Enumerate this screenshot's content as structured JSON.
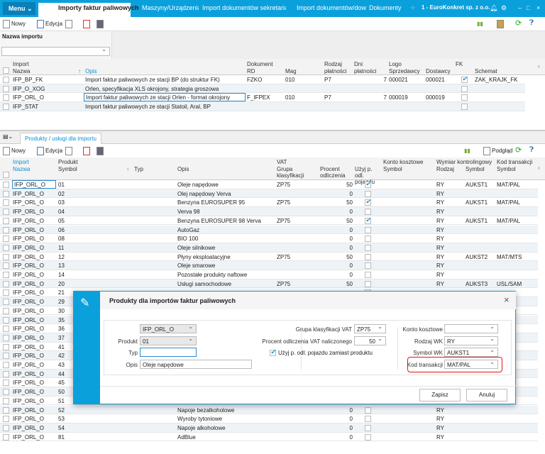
{
  "topbar": {
    "menu": "Menu",
    "tabs": [
      "Importy faktur paliwowych",
      "Maszyny/Urządzenia",
      "Import dokumentów sekretariatu",
      "Import dokumentów/dowodów",
      "Dokumenty"
    ],
    "company": "1 - EuroKonkret sp. z o.o."
  },
  "toolbar": {
    "new": "Nowy",
    "edit": "Edycja",
    "preview": "Podgląd"
  },
  "filter": {
    "label": "Nazwa importu",
    "value": ""
  },
  "top_grid": {
    "groups": {
      "import": "Import",
      "dokument": "Dokument",
      "rodzaj": "Rodzaj",
      "dni": "Dni",
      "logo": "Logo",
      "fk": "FK"
    },
    "cols": {
      "nazwa": "Nazwa",
      "opis": "Opis",
      "rd": "RD",
      "mag": "Mag",
      "rodzaj": "płatności",
      "dni": "płatności",
      "sprz": "Sprzedawcy",
      "dost": "Dostawcy",
      "schemat": "Schemat"
    },
    "rows": [
      {
        "nazwa": "IFP_BP_FK",
        "opis": "Import faktur paliwowych ze stacji BP (do struktur FK)",
        "rd": "FZKO",
        "mag": "010",
        "rodzaj": "P7",
        "dni": "7",
        "sprz": "000021",
        "dost": "000021",
        "fk": true,
        "schemat": "ZAK_KRAJK_FK"
      },
      {
        "nazwa": "IFP_O_XOG",
        "opis": "Orlen, specyfikacja XLS okrojony, strategia groszowa",
        "rd": "",
        "mag": "",
        "rodzaj": "",
        "dni": "",
        "sprz": "",
        "dost": "",
        "fk": false,
        "schemat": ""
      },
      {
        "nazwa": "IFP_ORL_O",
        "opis": "Import faktur paliwowych ze stacji Orlen - format okrojony",
        "rd": "F_IFPEX",
        "mag": "010",
        "rodzaj": "P7",
        "dni": "7",
        "sprz": "000019",
        "dost": "000019",
        "fk": false,
        "schemat": ""
      },
      {
        "nazwa": "IFP_STAT",
        "opis": "Import faktur paliwowych ze stacji Statoil, Aral, BP",
        "rd": "",
        "mag": "",
        "rodzaj": "",
        "dni": "",
        "sprz": "",
        "dost": "",
        "fk": false,
        "schemat": ""
      }
    ]
  },
  "bottom_tab": "Produkty / usługi dla importu",
  "bottom_grid": {
    "groups": {
      "import": "Import",
      "produkt": "Produkt",
      "vat": "VAT",
      "konto": "Konto kosztowe",
      "wymiar": "Wymiar kontrolingowy",
      "kod": "Kod transakcji"
    },
    "cols": {
      "nazwa": "Nazwa",
      "symbol": "Symbol",
      "typ": "Typ",
      "opis": "Opis",
      "grupa": "Grupa klasyfikacji",
      "procent": "Procent odliczenia",
      "uzyj": "Użyj p. odl. pojazdu",
      "konto": "Symbol",
      "rodzaj": "Rodzaj",
      "wsym": "Symbol",
      "kod": "Symbol"
    },
    "rows": [
      [
        "IFP_ORL_O",
        "01",
        "Oleje napędowe",
        "ZP75",
        "50",
        true,
        "RY",
        "AUKST1",
        "MAT/PAL"
      ],
      [
        "IFP_ORL_O",
        "02",
        "Olej napędowy Verva",
        "",
        "0",
        false,
        "RY",
        "",
        ""
      ],
      [
        "IFP_ORL_O",
        "03",
        "Benzyna EUROSUPER 95",
        "ZP75",
        "50",
        true,
        "RY",
        "AUKST1",
        "MAT/PAL"
      ],
      [
        "IFP_ORL_O",
        "04",
        "Verva 98",
        "",
        "0",
        false,
        "RY",
        "",
        ""
      ],
      [
        "IFP_ORL_O",
        "05",
        "Benzyna EUROSUPER 98 Verva",
        "ZP75",
        "50",
        true,
        "RY",
        "AUKST1",
        "MAT/PAL"
      ],
      [
        "IFP_ORL_O",
        "06",
        "AutoGaz",
        "",
        "0",
        false,
        "RY",
        "",
        ""
      ],
      [
        "IFP_ORL_O",
        "08",
        "BIO 100",
        "",
        "0",
        false,
        "RY",
        "",
        ""
      ],
      [
        "IFP_ORL_O",
        "11",
        "Oleje silnikowe",
        "",
        "0",
        false,
        "RY",
        "",
        ""
      ],
      [
        "IFP_ORL_O",
        "12",
        "Płyny eksploatacyjne",
        "ZP75",
        "50",
        false,
        "RY",
        "AUKST2",
        "MAT/MTS"
      ],
      [
        "IFP_ORL_O",
        "13",
        "Oleje smarowe",
        "",
        "0",
        false,
        "RY",
        "",
        ""
      ],
      [
        "IFP_ORL_O",
        "14",
        "Pozostałe produkty naftowe",
        "",
        "0",
        false,
        "RY",
        "",
        ""
      ],
      [
        "IFP_ORL_O",
        "20",
        "Usługi samochodowe",
        "ZP75",
        "50",
        false,
        "RY",
        "AUKST3",
        "USL/SAM"
      ],
      [
        "IFP_ORL_O",
        "21",
        "",
        "",
        "",
        false,
        "",
        "",
        ""
      ],
      [
        "IFP_ORL_O",
        "29",
        "",
        "",
        "",
        false,
        "",
        "",
        ""
      ],
      [
        "IFP_ORL_O",
        "30",
        "",
        "",
        "",
        false,
        "",
        "",
        ""
      ],
      [
        "IFP_ORL_O",
        "35",
        "",
        "",
        "",
        false,
        "",
        "",
        ""
      ],
      [
        "IFP_ORL_O",
        "36",
        "",
        "",
        "",
        false,
        "",
        "",
        ""
      ],
      [
        "IFP_ORL_O",
        "37",
        "",
        "",
        "",
        false,
        "",
        "",
        ""
      ],
      [
        "IFP_ORL_O",
        "41",
        "",
        "",
        "",
        false,
        "",
        "",
        ""
      ],
      [
        "IFP_ORL_O",
        "42",
        "",
        "",
        "",
        false,
        "",
        "",
        ""
      ],
      [
        "IFP_ORL_O",
        "43",
        "",
        "",
        "",
        false,
        "",
        "",
        ""
      ],
      [
        "IFP_ORL_O",
        "44",
        "",
        "",
        "",
        false,
        "",
        "",
        ""
      ],
      [
        "IFP_ORL_O",
        "45",
        "",
        "",
        "",
        false,
        "",
        "",
        ""
      ],
      [
        "IFP_ORL_O",
        "50",
        "",
        "",
        "",
        false,
        "",
        "",
        ""
      ],
      [
        "IFP_ORL_O",
        "51",
        "",
        "",
        "",
        false,
        "",
        "",
        ""
      ],
      [
        "IFP_ORL_O",
        "52",
        "Napoje bezalkoholowe",
        "",
        "0",
        false,
        "RY",
        "",
        ""
      ],
      [
        "IFP_ORL_O",
        "53",
        "Wyroby tytoniowe",
        "",
        "0",
        false,
        "RY",
        "",
        ""
      ],
      [
        "IFP_ORL_O",
        "54",
        "Napoje alkoholowe",
        "",
        "0",
        false,
        "RY",
        "",
        ""
      ],
      [
        "IFP_ORL_O",
        "81",
        "AdBlue",
        "",
        "0",
        false,
        "RY",
        "",
        ""
      ]
    ]
  },
  "dialog": {
    "title": "Produkty dla importów faktur paliwowych",
    "import_label": "Import",
    "import_value": "IFP_ORL_O",
    "produkt_label": "Produkt",
    "produkt_value": "01",
    "typ_label": "Typ",
    "typ_value": "",
    "opis_label": "Opis",
    "opis_value": "Oleje napędowe",
    "grupa_label": "Grupa klasyfikacji VAT",
    "grupa_value": "ZP75",
    "procent_label": "Procent odliczenia VAT naliczonego",
    "procent_value": "50",
    "uzyj_label": "Użyj p. odl. pojazdu zamiast produktu",
    "uzyj_checked": true,
    "konto_label": "Konto kosztowe",
    "konto_value": "",
    "rodzaj_label": "Rodzaj WK",
    "rodzaj_value": "RY",
    "symbol_label": "Symbol WK",
    "symbol_value": "AUKST1",
    "kod_label": "Kod transakcji",
    "kod_value": "MAT/PAL",
    "save": "Zapisz",
    "cancel": "Anuluj",
    "highlight_color": "#e0161b"
  },
  "colors": {
    "accent": "#0aa0dc"
  }
}
